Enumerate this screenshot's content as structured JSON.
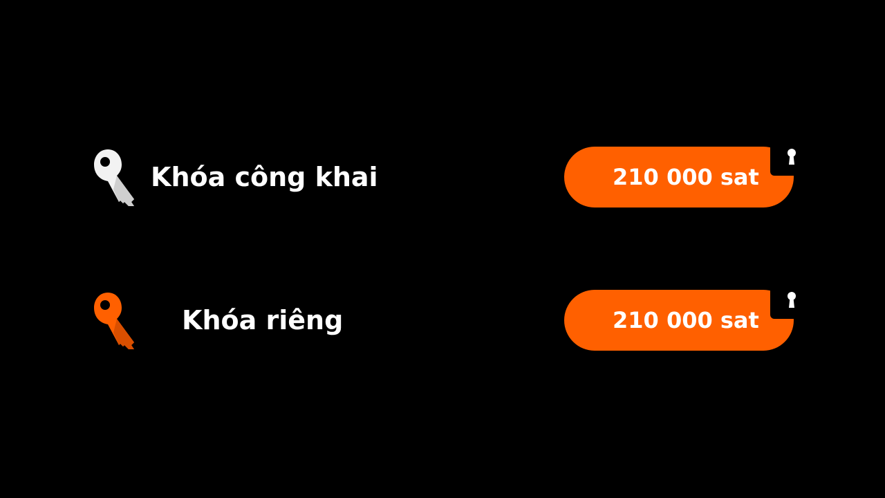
{
  "colors": {
    "background": "#000000",
    "accent": "#ff6000",
    "text": "#ffffff"
  },
  "rows": [
    {
      "icon": "white-key-icon",
      "label": "Khóa công khai",
      "amount": "210 000 sat",
      "lock_icon": "keyhole-icon"
    },
    {
      "icon": "orange-key-icon",
      "label": "Khóa riêng",
      "amount": "210 000 sat",
      "lock_icon": "keyhole-icon"
    }
  ]
}
